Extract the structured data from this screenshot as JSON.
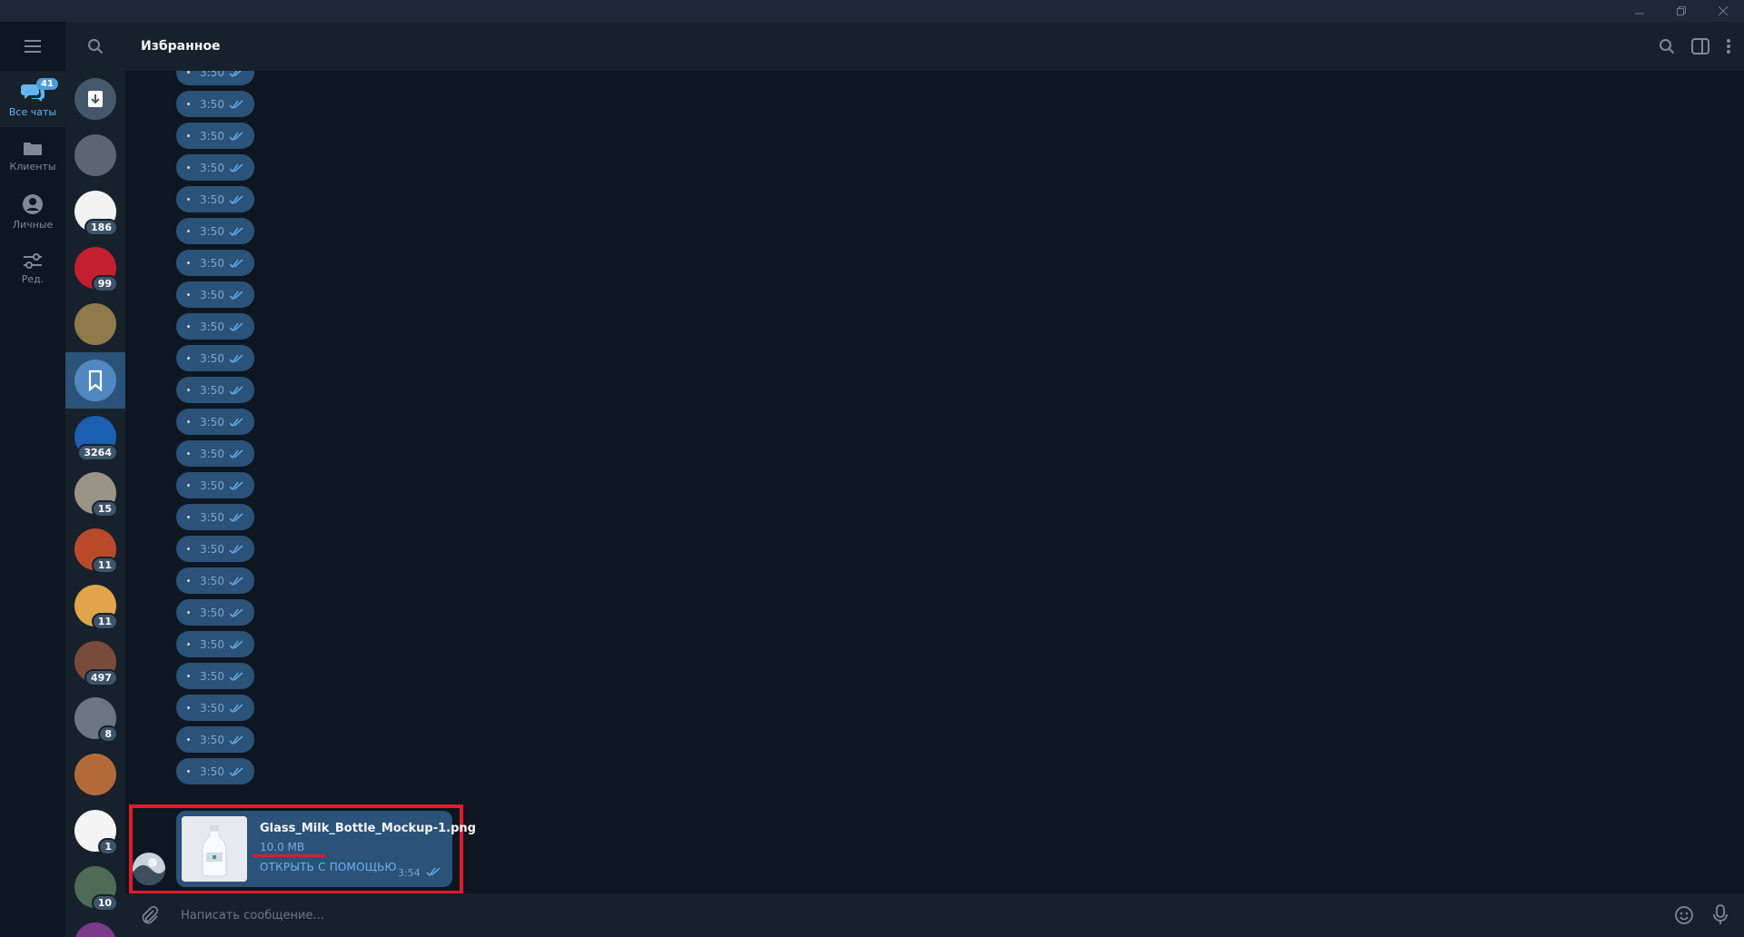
{
  "window": {
    "controls": [
      "minimize",
      "restore",
      "close"
    ]
  },
  "folders": [
    {
      "label": "Все чаты",
      "badge": "41",
      "icon": "chats-icon",
      "active": true
    },
    {
      "label": "Клиенты",
      "icon": "folder-icon"
    },
    {
      "label": "Личные",
      "icon": "person-icon"
    },
    {
      "label": "Ред.",
      "icon": "sliders-icon"
    }
  ],
  "chat_list": [
    {
      "name": "archive",
      "color": "#44576b",
      "icon": "archive-icon",
      "badge": ""
    },
    {
      "name": "chat-1",
      "color": "#5d6670",
      "badge": ""
    },
    {
      "name": "chat-2",
      "color": "#f2f2f2",
      "badge": "186"
    },
    {
      "name": "chat-3",
      "color": "#c41f2e",
      "badge": "99"
    },
    {
      "name": "chat-4",
      "color": "#8f7a4a",
      "badge": ""
    },
    {
      "name": "saved",
      "color": "#5288c1",
      "icon": "bookmark-icon",
      "badge": "",
      "active": true
    },
    {
      "name": "chat-6",
      "color": "#1b5fb0",
      "badge": "3264"
    },
    {
      "name": "chat-7",
      "color": "#9a9486",
      "badge": "15"
    },
    {
      "name": "chat-8",
      "color": "#b84a2a",
      "badge": "11"
    },
    {
      "name": "chat-9",
      "color": "#e0a44a",
      "badge": "11"
    },
    {
      "name": "chat-10",
      "color": "#7a4b3a",
      "badge": "497"
    },
    {
      "name": "chat-11",
      "color": "#6c7680",
      "badge": "8"
    },
    {
      "name": "chat-12",
      "color": "#b36a3a",
      "badge": ""
    },
    {
      "name": "chat-13",
      "color": "#f4f4f4",
      "badge": "1"
    },
    {
      "name": "chat-14",
      "color": "#4d6b55",
      "badge": "10"
    },
    {
      "name": "chat-15",
      "color": "#7b3a8a",
      "badge": ""
    }
  ],
  "header": {
    "title": "Избранное"
  },
  "messages": {
    "time": "3:50",
    "count": 23
  },
  "file_message": {
    "file_name": "Glass_Milk_Bottle_Mockup-1.png",
    "file_size": "10.0 MB",
    "open_with": "ОТКРЫТЬ С ПОМОЩЬЮ",
    "time": "3:54"
  },
  "composer": {
    "placeholder": "Написать сообщение..."
  },
  "colors": {
    "background": "#0e1621",
    "panel": "#17212b",
    "bubble": "#2b5278",
    "accent": "#64b5ef",
    "highlight_box": "#e21b2b"
  }
}
